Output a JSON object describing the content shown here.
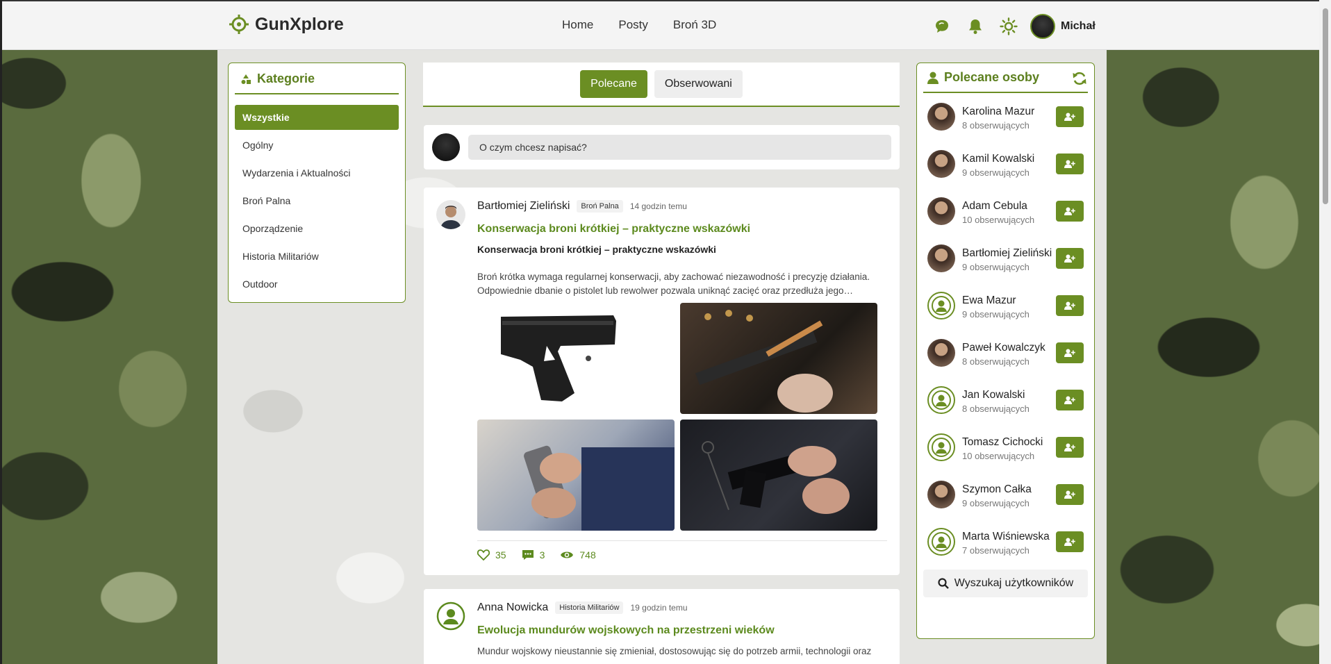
{
  "app": {
    "name": "GunXplore"
  },
  "nav": {
    "home": "Home",
    "posts": "Posty",
    "weapons3d": "Broń 3D"
  },
  "user": {
    "name": "Michał"
  },
  "categories": {
    "title": "Kategorie",
    "items": [
      "Wszystkie",
      "Ogólny",
      "Wydarzenia i Aktualności",
      "Broń Palna",
      "Oporządzenie",
      "Historia Militariów",
      "Outdoor"
    ],
    "active_index": 0
  },
  "feed": {
    "tabs": [
      "Polecane",
      "Obserwowani"
    ],
    "active_tab": 0,
    "composer_placeholder": "O czym chcesz napisać?",
    "posts": [
      {
        "author": "Bartłomiej Zieliński",
        "category": "Broń Palna",
        "time": "14 godzin temu",
        "title": "Konserwacja broni krótkiej – praktyczne wskazówki",
        "subtitle": "Konserwacja broni krótkiej – praktyczne wskazówki",
        "excerpt": "Broń krótka wymaga regularnej konserwacji, aby zachować niezawodność i precyzję działania. Odpowiednie dbanie o pistolet lub rewolwer pozwala uniknąć zacięć oraz przedłuża jego…",
        "likes": "35",
        "comments": "3",
        "views": "748"
      },
      {
        "author": "Anna Nowicka",
        "category": "Historia Militariów",
        "time": "19 godzin temu",
        "title": "Ewolucja mundurów wojskowych na przestrzeni wieków",
        "excerpt": "Mundur wojskowy nieustannie się zmieniał, dostosowując się do potrzeb armii, technologii oraz"
      }
    ]
  },
  "people": {
    "title": "Polecane osoby",
    "items": [
      {
        "name": "Karolina Mazur",
        "followers": "8 obserwujących",
        "avatar": "photo"
      },
      {
        "name": "Kamil Kowalski",
        "followers": "9 obserwujących",
        "avatar": "photo"
      },
      {
        "name": "Adam Cebula",
        "followers": "10 obserwujących",
        "avatar": "photo"
      },
      {
        "name": "Bartłomiej Zieliński",
        "followers": "9 obserwujących",
        "avatar": "photo"
      },
      {
        "name": "Ewa Mazur",
        "followers": "9 obserwujących",
        "avatar": "default"
      },
      {
        "name": "Paweł Kowalczyk",
        "followers": "8 obserwujących",
        "avatar": "photo"
      },
      {
        "name": "Jan Kowalski",
        "followers": "8 obserwujących",
        "avatar": "default"
      },
      {
        "name": "Tomasz Cichocki",
        "followers": "10 obserwujących",
        "avatar": "default"
      },
      {
        "name": "Szymon Całka",
        "followers": "9 obserwujących",
        "avatar": "photo"
      },
      {
        "name": "Marta Wiśniewska",
        "followers": "7 obserwujących",
        "avatar": "default"
      }
    ],
    "search_label": "Wyszukaj użytkowników"
  },
  "colors": {
    "accent": "#6b8e23",
    "accent_text": "#5c8a1e"
  }
}
